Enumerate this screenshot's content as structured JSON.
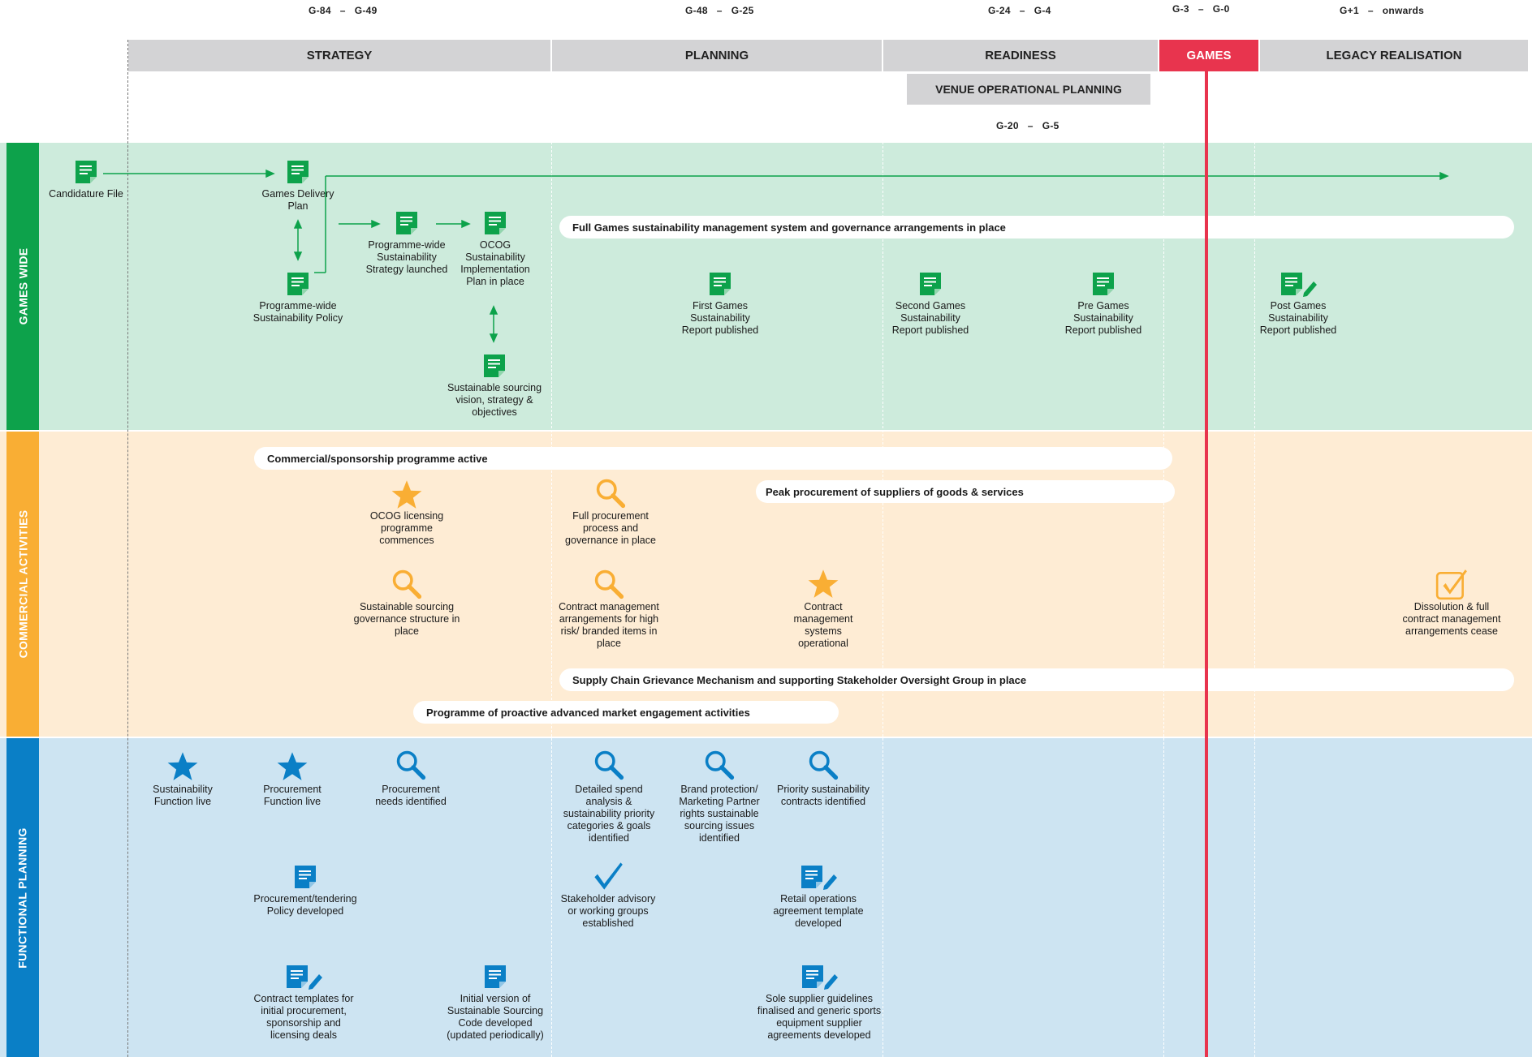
{
  "time_ranges": [
    {
      "start": "G-84",
      "end": "G-49"
    },
    {
      "start": "G-48",
      "end": "G-25"
    },
    {
      "start": "G-24",
      "end": "G-4"
    },
    {
      "start": "G-3",
      "end": "G-0"
    },
    {
      "start": "G+1",
      "end": "onwards"
    }
  ],
  "range_separator": "–",
  "phases": [
    "STRATEGY",
    "PLANNING",
    "READINESS",
    "GAMES",
    "LEGACY REALISATION"
  ],
  "venue_planning": {
    "label": "VENUE OPERATIONAL PLANNING",
    "start": "G-20",
    "end": "G-5"
  },
  "bands": {
    "games_wide": "GAMES WIDE",
    "commercial": "COMMERCIAL ACTIVITIES",
    "functional": "FUNCTIONAL PLANNING"
  },
  "colors": {
    "games_wide_bg": "#cdebdc",
    "games_wide_tab": "#0da24b",
    "commercial_bg": "#feecd4",
    "commercial_tab": "#f9ae34",
    "functional_bg": "#cde4f2",
    "functional_tab": "#0a7fc6",
    "games_red": "#e8344e",
    "phase_grey": "#d3d3d5"
  },
  "games_wide": {
    "candidature": "Candidature File",
    "delivery_plan": "Games Delivery Plan",
    "policy": "Programme-wide Sustainability Policy",
    "strategy": "Programme-wide Sustainability Strategy launched",
    "implementation": "OCOG Sustainability Implementation Plan in place",
    "sourcing": "Sustainable sourcing vision, strategy & objectives",
    "pill": "Full Games sustainability management system and governance arrangements in place",
    "report1": "First Games Sustainability Report published",
    "report2": "Second Games Sustainability Report published",
    "report3": "Pre Games Sustainability Report published",
    "report4": "Post Games Sustainability Report published"
  },
  "commercial": {
    "pill1": "Commercial/sponsorship programme active",
    "pill2": "Peak procurement of suppliers of goods & services",
    "pill3": "Supply Chain Grievance Mechanism and supporting Stakeholder Oversight Group in place",
    "pill4": "Programme of proactive advanced market engagement activities",
    "licensing": "OCOG licensing programme commences",
    "procurement_process": "Full procurement process and governance in place",
    "sourcing_gov": "Sustainable sourcing governance structure in place",
    "contract_mgmt": "Contract management arrangements for high risk/ branded items in place",
    "systems": "Contract management systems operational",
    "dissolution": "Dissolution & full contract management arrangements cease"
  },
  "functional": {
    "sus_function": "Sustainability Function live",
    "proc_function": "Procurement Function live",
    "proc_needs": "Procurement needs identified",
    "spend": "Detailed spend analysis & sustainability priority categories & goals identified",
    "brand": "Brand protection/ Marketing Partner rights sustainable sourcing issues identified",
    "priority": "Priority sustainability contracts identified",
    "tender_policy": "Procurement/tendering Policy developed",
    "advisory": "Stakeholder advisory or working groups established",
    "retail": "Retail operations agreement template developed",
    "templates": "Contract templates for initial procurement, sponsorship and licensing deals",
    "code": "Initial version of Sustainable Sourcing Code developed (updated periodically)",
    "supplier": "Sole supplier guidelines finalised and generic sports equipment supplier agreements developed"
  }
}
